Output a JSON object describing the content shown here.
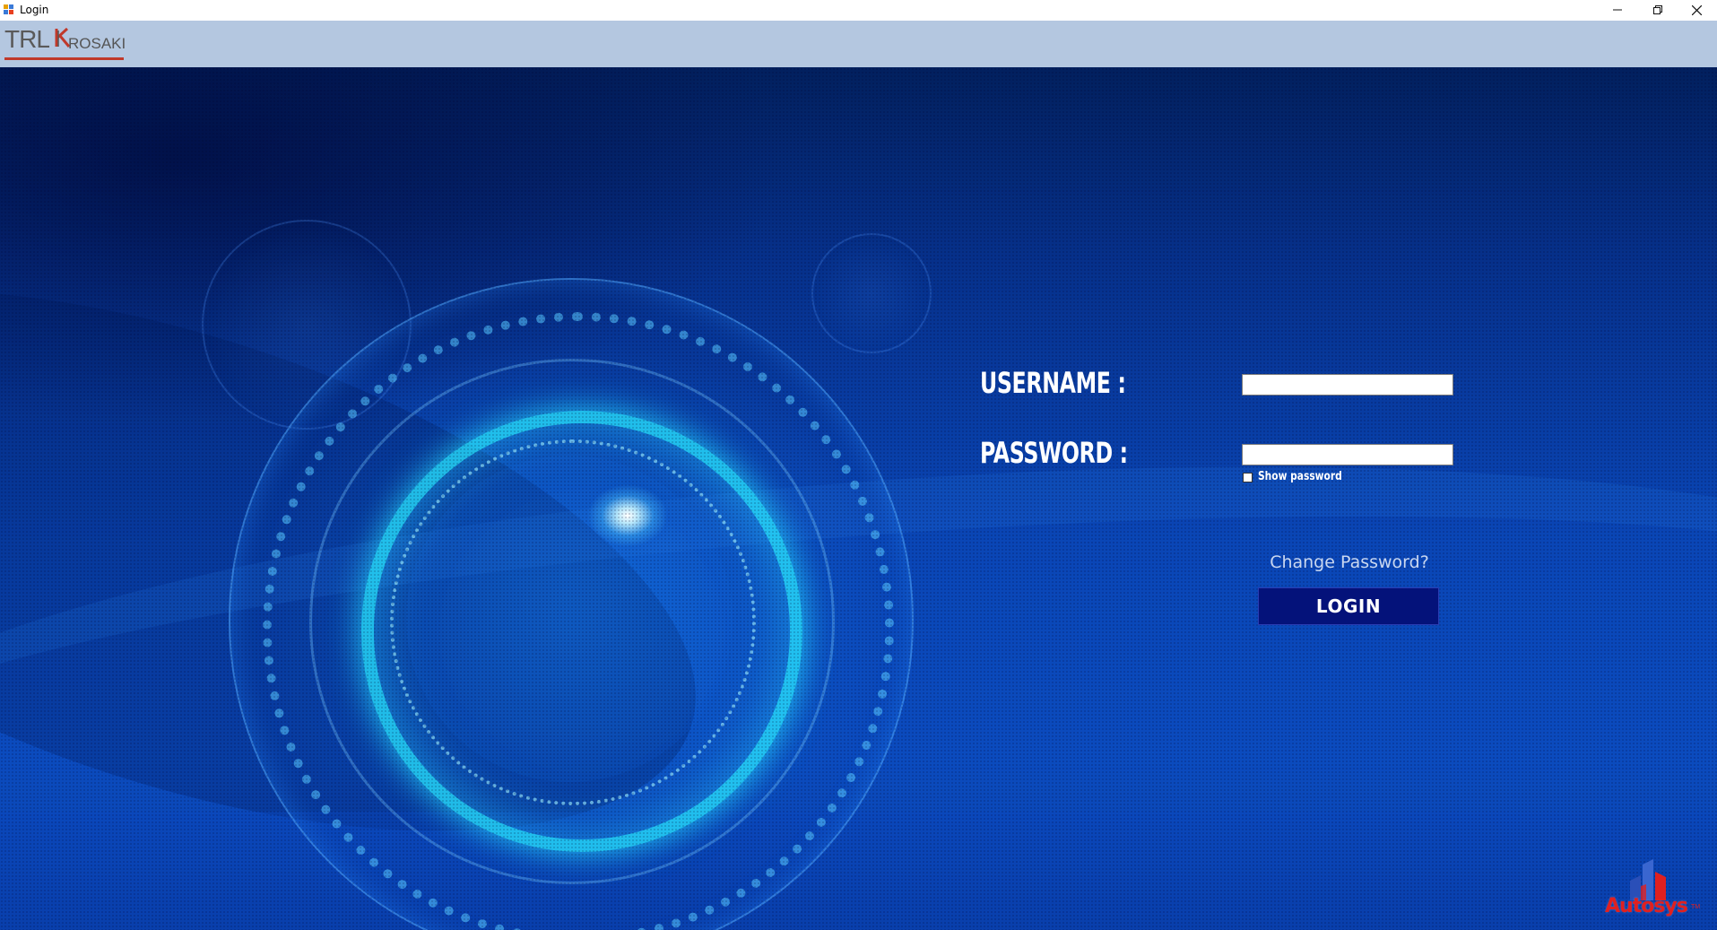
{
  "window": {
    "title": "Login",
    "controls": {
      "minimize_icon": "minimize-icon",
      "restore_icon": "restore-icon",
      "close_icon": "close-icon"
    }
  },
  "header": {
    "logo_text_trl": "TRL",
    "logo_text_krosaki": "ROSAKI",
    "logo_accent_color": "#c0392b"
  },
  "form": {
    "username_label": "USERNAME :",
    "username_value": "",
    "password_label": "PASSWORD :",
    "password_value": "",
    "show_password_label": "Show password",
    "show_password_checked": false,
    "change_password_link": "Change Password?",
    "login_button": "LOGIN"
  },
  "footer": {
    "brand_text": "Autosys",
    "brand_tm": "TM",
    "brand_color": "#e02020"
  },
  "colors": {
    "titlebar": "#ffffff",
    "logobar": "#b4c7e0",
    "background": "#0a46b6",
    "login_button": "#04127a"
  }
}
